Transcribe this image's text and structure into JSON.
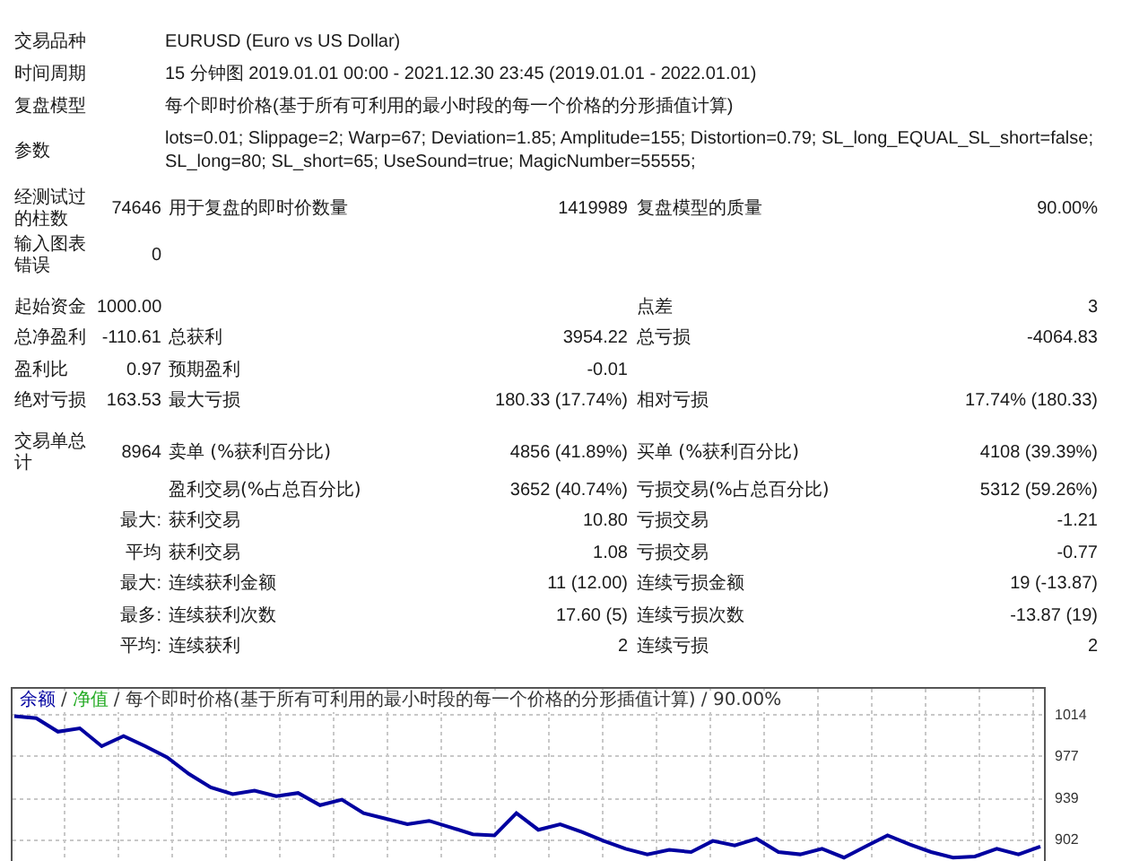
{
  "info_rows": [
    {
      "label": "交易品种",
      "value": "EURUSD (Euro vs US Dollar)"
    },
    {
      "label": "时间周期",
      "value": "15 分钟图 2019.01.01 00:00 - 2021.12.30 23:45 (2019.01.01 - 2022.01.01)"
    },
    {
      "label": "复盘模型",
      "value": "每个即时价格(基于所有可利用的最小时段的每一个价格的分形插值计算)"
    },
    {
      "label": "参数",
      "value": "lots=0.01; Slippage=2; Warp=67; Deviation=1.85; Amplitude=155; Distortion=0.79; SL_long_EQUAL_SL_short=false; SL_long=80; SL_short=65; UseSound=true; MagicNumber=55555;"
    }
  ],
  "stat_rows": [
    {
      "label": "经测试过的柱数",
      "value": "74646",
      "label_2": "用于复盘的即时价数量",
      "value_2": "1419989",
      "label_3": "复盘模型的质量",
      "value_3": "90.00%"
    },
    {
      "label": "输入图表错误",
      "value": "0"
    },
    {
      "label": "起始资金",
      "value": "1000.00",
      "label_3": "点差",
      "value_3": "3"
    },
    {
      "label": "总净盈利",
      "value": "-110.61",
      "label_2": "总获利",
      "value_2": "3954.22",
      "label_3": "总亏损",
      "value_3": "-4064.83"
    },
    {
      "label": "盈利比",
      "value": "0.97",
      "label_2": "预期盈利",
      "value_2": "-0.01"
    },
    {
      "label": "绝对亏损",
      "value": "163.53",
      "label_2": "最大亏损",
      "value_2": "180.33 (17.74%)",
      "label_3": "相对亏损",
      "value_3": "17.74% (180.33)"
    },
    {
      "label": "交易单总计",
      "value": "8964",
      "label_2": "卖单 (%获利百分比)",
      "value_2": "4856 (41.89%)",
      "label_3": "买单 (%获利百分比)",
      "value_3": "4108 (39.39%)"
    },
    {
      "label_2": "盈利交易(%占总百分比)",
      "value_2": "3652 (40.74%)",
      "label_3": "亏损交易(%占总百分比)",
      "value_3": "5312 (59.26%)"
    },
    {
      "value": "最大:",
      "label_2": "获利交易",
      "value_2": "10.80",
      "label_3": "亏损交易",
      "value_3": "-1.21"
    },
    {
      "value": "平均",
      "label_2": "获利交易",
      "value_2": "1.08",
      "label_3": "亏损交易",
      "value_3": "-0.77"
    },
    {
      "value": "最大:",
      "label_2": "连续获利金额",
      "value_2": "11 (12.00)",
      "label_3": "连续亏损金额",
      "value_3": "19 (-13.87)"
    },
    {
      "value": "最多:",
      "label_2": "连续获利次数",
      "value_2": "17.60 (5)",
      "label_3": "连续亏损次数",
      "value_3": "-13.87 (19)"
    },
    {
      "value": "平均:",
      "label_2": "连续获利",
      "value_2": "2",
      "label_3": "连续亏损",
      "value_3": "2"
    }
  ],
  "chart": {
    "caption": [
      {
        "text": "/",
        "color": "#333333"
      },
      {
        "text": "净值",
        "color": "#22aa22"
      },
      {
        "text": "/ 每个即时价格(基于所有可利用的最小时段的每一个价格的分形插值计算) / 90.00%",
        "color": "#333333"
      }
    ],
    "chart_data": {
      "type": "line",
      "grid": true,
      "ylim": [
        882,
        1038
      ],
      "yticks": [
        1014,
        977,
        939,
        902
      ],
      "series": [
        {
          "name": "余额",
          "color": "#0000a0",
          "values": [
            1012,
            1010,
            998,
            1001,
            985,
            994,
            985,
            975,
            960,
            948,
            942,
            945,
            940,
            943,
            932,
            937,
            925,
            920,
            915,
            918,
            912,
            906,
            905,
            925,
            910,
            915,
            908,
            900,
            893,
            888,
            892,
            890,
            900,
            896,
            902,
            890,
            888,
            893,
            885,
            895,
            905,
            897,
            890,
            885,
            886,
            893,
            888,
            895
          ]
        }
      ]
    }
  }
}
